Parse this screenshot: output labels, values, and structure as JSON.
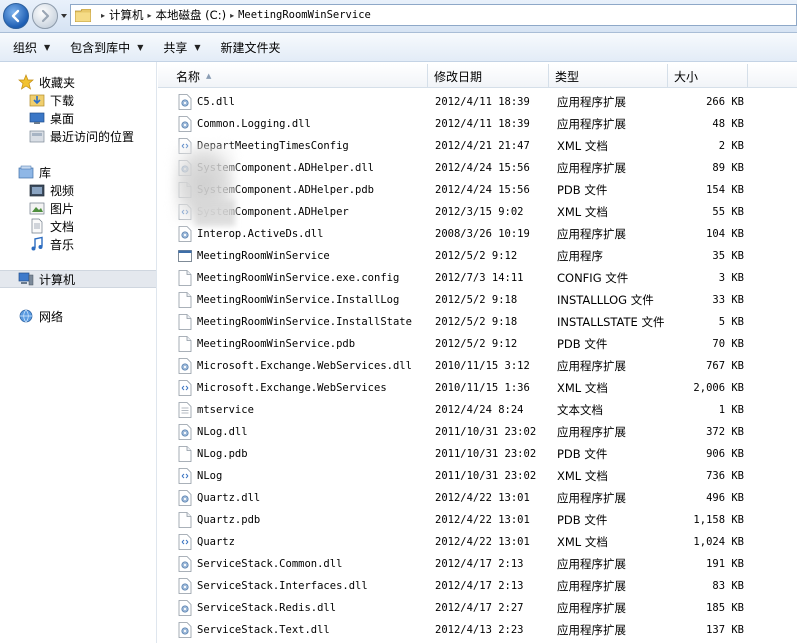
{
  "address": {
    "crumbs": [
      "计算机",
      "本地磁盘 (C:)",
      "MeetingRoomWinService"
    ]
  },
  "toolbar": {
    "organize": "组织",
    "include_library": "包含到库中",
    "share": "共享",
    "new_folder": "新建文件夹"
  },
  "nav": {
    "favorites": "收藏夹",
    "downloads": "下载",
    "desktop": "桌面",
    "recent": "最近访问的位置",
    "libraries": "库",
    "videos": "视频",
    "pictures": "图片",
    "documents": "文档",
    "music": "音乐",
    "computer": "计算机",
    "network": "网络"
  },
  "columns": {
    "name": "名称",
    "date": "修改日期",
    "type": "类型",
    "size": "大小"
  },
  "files": [
    {
      "name": "C5.dll",
      "date": "2012/4/11 18:39",
      "type": "应用程序扩展",
      "size": "266 KB",
      "icon": "dll-icon"
    },
    {
      "name": "Common.Logging.dll",
      "date": "2012/4/11 18:39",
      "type": "应用程序扩展",
      "size": "48 KB",
      "icon": "dll-icon"
    },
    {
      "name": "DepartMeetingTimesConfig",
      "date": "2012/4/21 21:47",
      "type": "XML 文档",
      "size": "2 KB",
      "icon": "xml-icon"
    },
    {
      "name": "SystemComponent.ADHelper.dll",
      "date": "2012/4/24 15:56",
      "type": "应用程序扩展",
      "size": "89 KB",
      "icon": "dll-icon"
    },
    {
      "name": "SystemComponent.ADHelper.pdb",
      "date": "2012/4/24 15:56",
      "type": "PDB 文件",
      "size": "154 KB",
      "icon": "file-icon"
    },
    {
      "name": "SystemComponent.ADHelper",
      "date": "2012/3/15 9:02",
      "type": "XML 文档",
      "size": "55 KB",
      "icon": "xml-icon"
    },
    {
      "name": "Interop.ActiveDs.dll",
      "date": "2008/3/26 10:19",
      "type": "应用程序扩展",
      "size": "104 KB",
      "icon": "dll-icon"
    },
    {
      "name": "MeetingRoomWinService",
      "date": "2012/5/2 9:12",
      "type": "应用程序",
      "size": "35 KB",
      "icon": "exe-icon"
    },
    {
      "name": "MeetingRoomWinService.exe.config",
      "date": "2012/7/3 14:11",
      "type": "CONFIG 文件",
      "size": "3 KB",
      "icon": "file-icon"
    },
    {
      "name": "MeetingRoomWinService.InstallLog",
      "date": "2012/5/2 9:18",
      "type": "INSTALLLOG 文件",
      "size": "33 KB",
      "icon": "file-icon"
    },
    {
      "name": "MeetingRoomWinService.InstallState",
      "date": "2012/5/2 9:18",
      "type": "INSTALLSTATE 文件",
      "size": "5 KB",
      "icon": "file-icon"
    },
    {
      "name": "MeetingRoomWinService.pdb",
      "date": "2012/5/2 9:12",
      "type": "PDB 文件",
      "size": "70 KB",
      "icon": "file-icon"
    },
    {
      "name": "Microsoft.Exchange.WebServices.dll",
      "date": "2010/11/15 3:12",
      "type": "应用程序扩展",
      "size": "767 KB",
      "icon": "dll-icon"
    },
    {
      "name": "Microsoft.Exchange.WebServices",
      "date": "2010/11/15 1:36",
      "type": "XML 文档",
      "size": "2,006 KB",
      "icon": "xml-icon"
    },
    {
      "name": "mtservice",
      "date": "2012/4/24 8:24",
      "type": "文本文档",
      "size": "1 KB",
      "icon": "text-icon"
    },
    {
      "name": "NLog.dll",
      "date": "2011/10/31 23:02",
      "type": "应用程序扩展",
      "size": "372 KB",
      "icon": "dll-icon"
    },
    {
      "name": "NLog.pdb",
      "date": "2011/10/31 23:02",
      "type": "PDB 文件",
      "size": "906 KB",
      "icon": "file-icon"
    },
    {
      "name": "NLog",
      "date": "2011/10/31 23:02",
      "type": "XML 文档",
      "size": "736 KB",
      "icon": "xml-icon"
    },
    {
      "name": "Quartz.dll",
      "date": "2012/4/22 13:01",
      "type": "应用程序扩展",
      "size": "496 KB",
      "icon": "dll-icon"
    },
    {
      "name": "Quartz.pdb",
      "date": "2012/4/22 13:01",
      "type": "PDB 文件",
      "size": "1,158 KB",
      "icon": "file-icon"
    },
    {
      "name": "Quartz",
      "date": "2012/4/22 13:01",
      "type": "XML 文档",
      "size": "1,024 KB",
      "icon": "xml-icon"
    },
    {
      "name": "ServiceStack.Common.dll",
      "date": "2012/4/17 2:13",
      "type": "应用程序扩展",
      "size": "191 KB",
      "icon": "dll-icon"
    },
    {
      "name": "ServiceStack.Interfaces.dll",
      "date": "2012/4/17 2:13",
      "type": "应用程序扩展",
      "size": "83 KB",
      "icon": "dll-icon"
    },
    {
      "name": "ServiceStack.Redis.dll",
      "date": "2012/4/17 2:27",
      "type": "应用程序扩展",
      "size": "185 KB",
      "icon": "dll-icon"
    },
    {
      "name": "ServiceStack.Text.dll",
      "date": "2012/4/13 2:23",
      "type": "应用程序扩展",
      "size": "137 KB",
      "icon": "dll-icon"
    }
  ]
}
